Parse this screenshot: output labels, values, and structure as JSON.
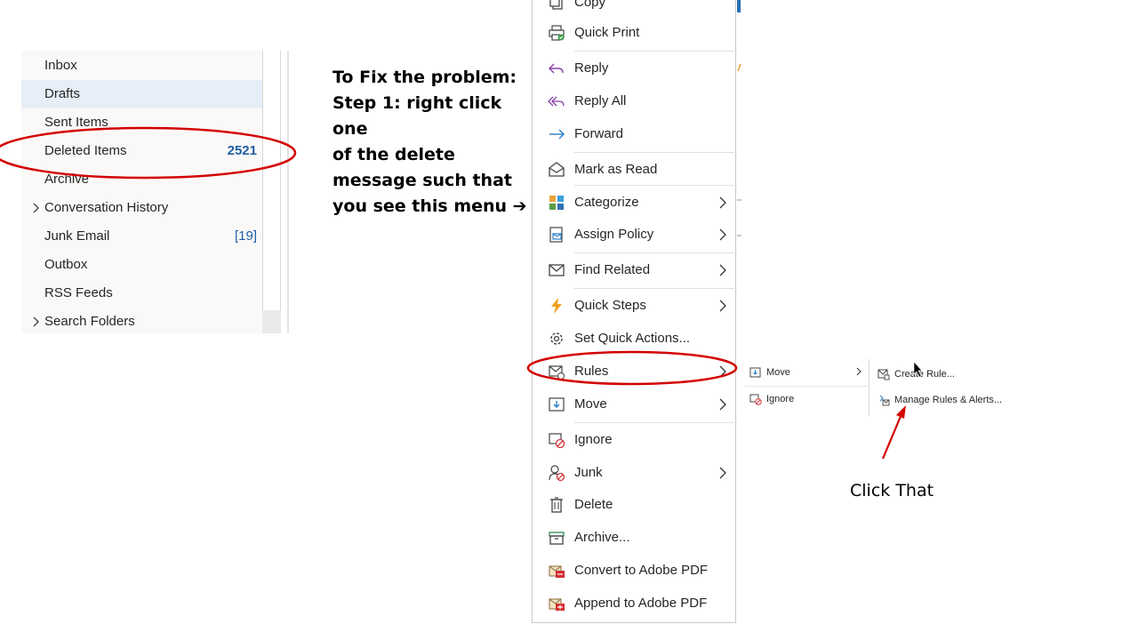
{
  "folders": [
    {
      "label": "Inbox",
      "count": "",
      "expandable": false
    },
    {
      "label": "Drafts",
      "count": "",
      "expandable": false,
      "selected": true
    },
    {
      "label": "Sent Items",
      "count": "",
      "expandable": false
    },
    {
      "label": "Deleted Items",
      "count": "2521",
      "expandable": false
    },
    {
      "label": "Archive",
      "count": "",
      "expandable": false
    },
    {
      "label": "Conversation History",
      "count": "",
      "expandable": true
    },
    {
      "label": "Junk Email",
      "count": "[19]",
      "expandable": false
    },
    {
      "label": "Outbox",
      "count": "",
      "expandable": false
    },
    {
      "label": "RSS Feeds",
      "count": "",
      "expandable": false
    },
    {
      "label": "Search Folders",
      "count": "",
      "expandable": true
    }
  ],
  "instruction": {
    "lines": [
      "To Fix the problem:",
      "Step 1: right click one",
      "of the delete",
      "message such that",
      "you see this menu ➔"
    ]
  },
  "context_menu": {
    "items": [
      {
        "label": "Copy",
        "icon": "copy-icon"
      },
      {
        "label": "Quick Print",
        "icon": "quick-print-icon"
      },
      {
        "label": "Reply",
        "icon": "reply-icon"
      },
      {
        "label": "Reply All",
        "icon": "reply-all-icon"
      },
      {
        "label": "Forward",
        "icon": "forward-icon"
      },
      {
        "label": "Mark as Read",
        "icon": "envelope-open-icon"
      },
      {
        "label": "Categorize",
        "icon": "categorize-icon",
        "submenu": true
      },
      {
        "label": "Assign Policy",
        "icon": "assign-policy-icon",
        "submenu": true
      },
      {
        "label": "Find Related",
        "icon": "find-related-icon",
        "submenu": true
      },
      {
        "label": "Quick Steps",
        "icon": "lightning-icon",
        "submenu": true
      },
      {
        "label": "Set Quick Actions...",
        "icon": "gear-icon"
      },
      {
        "label": "Rules",
        "icon": "rules-icon",
        "submenu": true
      },
      {
        "label": "Move",
        "icon": "move-icon",
        "submenu": true
      },
      {
        "label": "Ignore",
        "icon": "ignore-icon"
      },
      {
        "label": "Junk",
        "icon": "junk-icon",
        "submenu": true
      },
      {
        "label": "Delete",
        "icon": "trash-icon"
      },
      {
        "label": "Archive...",
        "icon": "archive-icon"
      },
      {
        "label": "Convert to Adobe PDF",
        "icon": "pdf-convert-icon"
      },
      {
        "label": "Append to Adobe PDF",
        "icon": "pdf-append-icon"
      }
    ]
  },
  "submenu_rules": {
    "items": [
      {
        "label": "Move",
        "icon": "move-icon",
        "submenu": true
      },
      {
        "label": "Ignore",
        "icon": "ignore-icon"
      }
    ]
  },
  "submenu_move": {
    "items": [
      {
        "label": "Create Rule...",
        "icon": "create-rule-icon"
      },
      {
        "label": "Manage Rules & Alerts...",
        "icon": "manage-rules-icon"
      }
    ]
  },
  "annotation": {
    "click_label": "Click That",
    "highlight_color": "#d40000"
  }
}
